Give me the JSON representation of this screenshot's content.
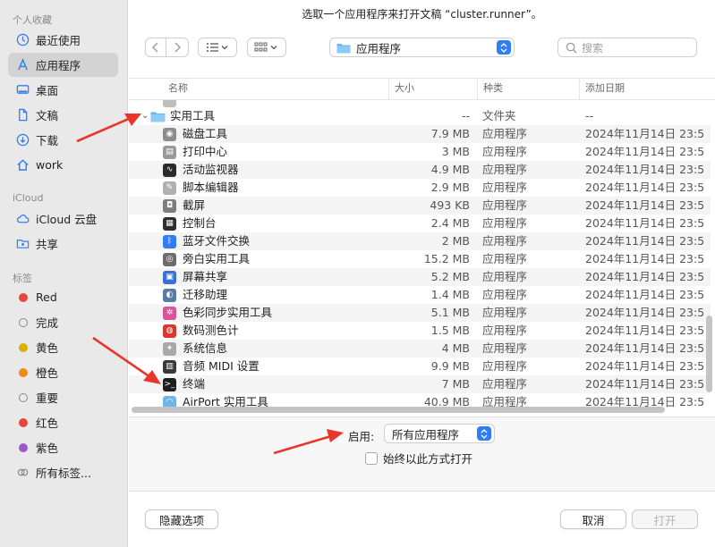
{
  "dialog": {
    "title": "选取一个应用程序来打开文稿 “cluster.runner”。"
  },
  "sidebar": {
    "favorites_label": "个人收藏",
    "favorites": [
      {
        "label": "最近使用",
        "icon": "clock-icon"
      },
      {
        "label": "应用程序",
        "icon": "applications-icon",
        "active": true
      },
      {
        "label": "桌面",
        "icon": "desktop-icon"
      },
      {
        "label": "文稿",
        "icon": "document-icon"
      },
      {
        "label": "下载",
        "icon": "download-icon"
      },
      {
        "label": "work",
        "icon": "home-icon"
      }
    ],
    "icloud_label": "iCloud",
    "icloud": [
      {
        "label": "iCloud 云盘",
        "icon": "cloud-icon"
      },
      {
        "label": "共享",
        "icon": "shared-folder-icon"
      }
    ],
    "tags_label": "标签",
    "tags": [
      {
        "label": "Red",
        "color": "#e8453c"
      },
      {
        "label": "完成",
        "color": ""
      },
      {
        "label": "黄色",
        "color": "#d9b000"
      },
      {
        "label": "橙色",
        "color": "#ef8a1a"
      },
      {
        "label": "重要",
        "color": ""
      },
      {
        "label": "红色",
        "color": "#e8453c"
      },
      {
        "label": "紫色",
        "color": "#9b59c9"
      }
    ],
    "all_tags_label": "所有标签..."
  },
  "toolbar": {
    "location": "应用程序",
    "search_placeholder": "搜索"
  },
  "columns": {
    "name": "名称",
    "size": "大小",
    "kind": "种类",
    "date": "添加日期"
  },
  "folder": {
    "name": "实用工具",
    "size": "--",
    "kind": "文件夹",
    "date": "--"
  },
  "files": [
    {
      "name": "磁盘工具",
      "size": "7.9 MB",
      "kind": "应用程序",
      "date": "2024年11月14日 23:5",
      "color": "#8c8c8c",
      "glyph": "◉"
    },
    {
      "name": "打印中心",
      "size": "3 MB",
      "kind": "应用程序",
      "date": "2024年11月14日 23:5",
      "color": "#9a9a9a",
      "glyph": "▤"
    },
    {
      "name": "活动监视器",
      "size": "4.9 MB",
      "kind": "应用程序",
      "date": "2024年11月14日 23:5",
      "color": "#2b2b2b",
      "glyph": "∿"
    },
    {
      "name": "脚本编辑器",
      "size": "2.9 MB",
      "kind": "应用程序",
      "date": "2024年11月14日 23:5",
      "color": "#b0b0b0",
      "glyph": "✎"
    },
    {
      "name": "截屏",
      "size": "493 KB",
      "kind": "应用程序",
      "date": "2024年11月14日 23:5",
      "color": "#7d7d7d",
      "glyph": "◘"
    },
    {
      "name": "控制台",
      "size": "2.4 MB",
      "kind": "应用程序",
      "date": "2024年11月14日 23:5",
      "color": "#2e2e2e",
      "glyph": "▦"
    },
    {
      "name": "蓝牙文件交换",
      "size": "2 MB",
      "kind": "应用程序",
      "date": "2024年11月14日 23:5",
      "color": "#2f7ef6",
      "glyph": "ᛒ"
    },
    {
      "name": "旁白实用工具",
      "size": "15.2 MB",
      "kind": "应用程序",
      "date": "2024年11月14日 23:5",
      "color": "#6d6d6d",
      "glyph": "◎"
    },
    {
      "name": "屏幕共享",
      "size": "5.2 MB",
      "kind": "应用程序",
      "date": "2024年11月14日 23:5",
      "color": "#3a6fd8",
      "glyph": "▣"
    },
    {
      "name": "迁移助理",
      "size": "1.4 MB",
      "kind": "应用程序",
      "date": "2024年11月14日 23:5",
      "color": "#5a7aa8",
      "glyph": "◐"
    },
    {
      "name": "色彩同步实用工具",
      "size": "5.1 MB",
      "kind": "应用程序",
      "date": "2024年11月14日 23:5",
      "color": "#d9559a",
      "glyph": "✲"
    },
    {
      "name": "数码测色计",
      "size": "1.5 MB",
      "kind": "应用程序",
      "date": "2024年11月14日 23:5",
      "color": "#d9382e",
      "glyph": "◍"
    },
    {
      "name": "系统信息",
      "size": "4 MB",
      "kind": "应用程序",
      "date": "2024年11月14日 23:5",
      "color": "#a8a8a8",
      "glyph": "✦"
    },
    {
      "name": "音频 MIDI 设置",
      "size": "9.9 MB",
      "kind": "应用程序",
      "date": "2024年11月14日 23:5",
      "color": "#3a3a3a",
      "glyph": "▥"
    },
    {
      "name": "终端",
      "size": "7 MB",
      "kind": "应用程序",
      "date": "2024年11月14日 23:5",
      "color": "#1e1e1e",
      "glyph": ">_"
    },
    {
      "name": "AirPort 实用工具",
      "size": "40.9 MB",
      "kind": "应用程序",
      "date": "2024年11月14日 23:5",
      "color": "#6fb6e8",
      "glyph": "◠"
    }
  ],
  "options": {
    "enable_label": "启用:",
    "enable_value": "所有应用程序",
    "always_open_label": "始终以此方式打开"
  },
  "buttons": {
    "hide_options": "隐藏选项",
    "cancel": "取消",
    "open": "打开"
  },
  "colors": {
    "accent": "#2f7ef6",
    "annotation": "#e8362b"
  }
}
